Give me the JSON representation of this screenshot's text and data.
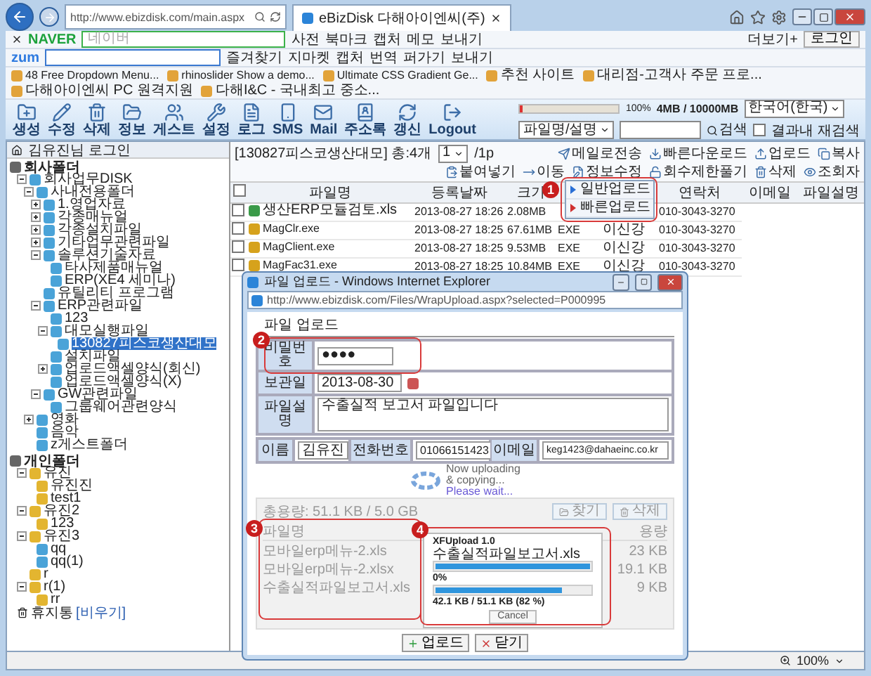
{
  "browser": {
    "address": "http://www.ebizdisk.com/main.aspx",
    "tab": {
      "title": "eBizDisk 다해아이엔씨(주)"
    }
  },
  "naver_bar": {
    "brand": "NAVER",
    "placeholder": "네이버",
    "items": [
      "사전",
      "북마크",
      "캡처",
      "메모",
      "보내기"
    ],
    "more": "더보기+",
    "login": "로그인"
  },
  "zum_bar": {
    "brand": "zum",
    "items": [
      "즐겨찾기",
      "지마켓",
      "캡처",
      "번역",
      "퍼가기",
      "보내기"
    ]
  },
  "favorites": [
    "48 Free Dropdown Menu...",
    "rhinoslider Show a demo...",
    "Ultimate CSS Gradient Ge...",
    "추천 사이트",
    "대리점-고객사 주문 프로...",
    "다해아이엔씨 PC 원격지원",
    "다해I&C - 국내최고 중소..."
  ],
  "app_toolbar": {
    "buttons": [
      "생성",
      "수정",
      "삭제",
      "정보",
      "게스트",
      "설정",
      "로그",
      "SMS",
      "Mail",
      "주소록",
      "갱신",
      "Logout"
    ],
    "quota": {
      "level": 0.02,
      "max_label": "100%",
      "reading": "4MB / 10000MB"
    },
    "language": "한국어(한국)",
    "search_field": "파일명/설명",
    "search_button": "검색",
    "research": {
      "label": "결과내 재검색",
      "checked": false
    }
  },
  "sidebar": {
    "user": "김유진님 로그인",
    "sections": [
      {
        "title": "회사폴더",
        "items": [
          {
            "label": "회사업무DISK",
            "kind": "shared",
            "selected": false,
            "expanded": true,
            "children": [
              {
                "label": "사내전용폴더",
                "kind": "shared",
                "selected": false,
                "expanded": true,
                "children": [
                  {
                    "label": "1.영업자료",
                    "kind": "shared",
                    "selected": false,
                    "expanded": false
                  },
                  {
                    "label": "각종매뉴얼",
                    "kind": "shared",
                    "selected": false,
                    "expanded": false
                  },
                  {
                    "label": "각종설치파일",
                    "kind": "shared",
                    "selected": false,
                    "expanded": false
                  },
                  {
                    "label": "기타업무관련파일",
                    "kind": "shared",
                    "selected": false,
                    "expanded": false
                  },
                  {
                    "label": "솔루션기술자료",
                    "kind": "shared",
                    "selected": false,
                    "expanded": true,
                    "children": [
                      {
                        "label": "타사제품매뉴얼",
                        "kind": "shared",
                        "selected": false
                      },
                      {
                        "label": "ERP(XE4 세미나)",
                        "kind": "shared",
                        "selected": false
                      }
                    ]
                  },
                  {
                    "label": "유틸리티 프로그램",
                    "kind": "shared",
                    "selected": false
                  },
                  {
                    "label": "ERP관련파일",
                    "kind": "shared",
                    "selected": false,
                    "expanded": true,
                    "children": [
                      {
                        "label": "123",
                        "kind": "shared",
                        "selected": false
                      },
                      {
                        "label": "대모실행파일",
                        "kind": "shared",
                        "selected": false,
                        "expanded": true,
                        "children": [
                          {
                            "label": "130827피스코생산대모",
                            "kind": "shared",
                            "selected": true
                          }
                        ]
                      },
                      {
                        "label": "설치파일",
                        "kind": "shared",
                        "selected": false
                      },
                      {
                        "label": "업로드액셀양식(회신)",
                        "kind": "shared",
                        "selected": false,
                        "expanded": false
                      },
                      {
                        "label": "업로드액셀양식(X)",
                        "kind": "shared",
                        "selected": false
                      }
                    ]
                  },
                  {
                    "label": "GW관련파일",
                    "kind": "shared",
                    "selected": false,
                    "expanded": true,
                    "children": [
                      {
                        "label": "그룹웨어관련양식",
                        "kind": "shared",
                        "selected": false
                      }
                    ]
                  }
                ]
              },
              {
                "label": "영화",
                "kind": "shared",
                "selected": false,
                "expanded": false
              },
              {
                "label": "음악",
                "kind": "shared",
                "selected": false
              },
              {
                "label": "z게스트폴더",
                "kind": "shared",
                "selected": false
              }
            ]
          }
        ]
      },
      {
        "title": "개인폴더",
        "items": [
          {
            "label": "유진",
            "kind": "personal",
            "selected": false,
            "expanded": true,
            "children": [
              {
                "label": "유진진",
                "kind": "personal",
                "selected": false
              },
              {
                "label": "test1",
                "kind": "personal",
                "selected": false
              }
            ]
          },
          {
            "label": "유진2",
            "kind": "personal",
            "selected": false,
            "expanded": true,
            "children": [
              {
                "label": "123",
                "kind": "personal",
                "selected": false
              }
            ]
          },
          {
            "label": "유진3",
            "kind": "personal",
            "selected": false,
            "expanded": true,
            "children": [
              {
                "label": "qq",
                "kind": "shared",
                "selected": false
              },
              {
                "label": "qq(1)",
                "kind": "shared",
                "selected": false
              }
            ]
          },
          {
            "label": "r",
            "kind": "personal",
            "selected": false
          },
          {
            "label": "r(1)",
            "kind": "personal",
            "selected": false,
            "expanded": true,
            "children": [
              {
                "label": "rr",
                "kind": "personal",
                "selected": false
              }
            ]
          }
        ]
      }
    ],
    "trash": {
      "label": "휴지통",
      "link": "[비우기]"
    }
  },
  "file_panel": {
    "path": "[130827피스코생산대모] 총:4개",
    "page": "1",
    "pages": "/1p",
    "actions": [
      {
        "label": "메일로전송"
      },
      {
        "label": "빠른다운로드"
      },
      {
        "label": "업로드",
        "menu": [
          {
            "label": "일반업로드",
            "color": "#2a6fd6"
          },
          {
            "label": "빠른업로드",
            "color": "#d03030"
          }
        ]
      },
      {
        "label": "복사"
      },
      {
        "label": "붙여넣기"
      },
      {
        "label": "이동"
      },
      {
        "label": "정보수정"
      },
      {
        "label": "회수제한풀기"
      },
      {
        "label": "삭제"
      },
      {
        "label": "조회자"
      }
    ],
    "select_all": {
      "checked": false
    },
    "columns": [
      {
        "label": "파일명"
      },
      {
        "label": "등록날짜"
      },
      {
        "label": "크기"
      },
      {},
      {},
      {
        "label": "연락처"
      },
      {
        "label": "이메일"
      },
      {
        "label": "파일설명"
      }
    ],
    "rows": [
      {
        "checked": false,
        "kind": "excel",
        "cells": [
          "생산ERP모듈검토.xls",
          "2013-08-27 18:26",
          "2.08MB",
          "",
          "",
          "010-3043-3270"
        ]
      },
      {
        "checked": false,
        "kind": "program",
        "cells": [
          "MagClr.exe",
          "2013-08-27 18:25",
          "67.61MB",
          "EXE",
          "이신강",
          "010-3043-3270"
        ]
      },
      {
        "checked": false,
        "kind": "program",
        "cells": [
          "MagClient.exe",
          "2013-08-27 18:25",
          "9.53MB",
          "EXE",
          "이신강",
          "010-3043-3270"
        ]
      },
      {
        "checked": false,
        "kind": "program",
        "cells": [
          "MagFac31.exe",
          "2013-08-27 18:25",
          "10.84MB",
          "EXE",
          "이신강",
          "010-3043-3270"
        ]
      }
    ]
  },
  "dialog": {
    "title": "파일 업로드 - Windows Internet Explorer",
    "url": "http://www.ebizdisk.com/Files/WrapUpload.aspx?selected=P000995",
    "heading": "파일 업로드",
    "password": {
      "label": "비밀번호",
      "value": "●●●●"
    },
    "keep_date": {
      "label": "보관일",
      "value": "2013-08-30"
    },
    "description": {
      "label": "파일설명",
      "value": "수출실적 보고서 파일입니다"
    },
    "name": {
      "label": "이름",
      "value": "김유진"
    },
    "phone": {
      "label": "전화번호",
      "value": "01066151423"
    },
    "email": {
      "label": "이메일",
      "value": "keg1423@dahaeinc.co.kr"
    },
    "wait": {
      "line1": "Now uploading",
      "line2": "& copying...",
      "line3": "Please wait..."
    },
    "upload": {
      "total": "총용량: 51.1 KB / 5.0 GB",
      "find": "찾기",
      "remove": "삭제",
      "columns": [
        "파일명",
        "용량"
      ],
      "files": [
        {
          "name": "모바일erp메뉴-2.xls",
          "size": "23 KB"
        },
        {
          "name": "모바일erp메뉴-2.xlsx",
          "size": "19.1 KB"
        },
        {
          "name": "수출실적파일보고서.xls",
          "size": "9 KB"
        }
      ],
      "progress": {
        "title": "XFUpload 1.0",
        "file": "수출실적파일보고서.xls",
        "file_bar": {
          "level": 1
        },
        "percent": "0%",
        "total_bar": {
          "level": 0.82
        },
        "reading": "42.1 KB / 51.1 KB (82 %)",
        "cancel": "Cancel"
      }
    },
    "buttons": [
      "업로드",
      "닫기"
    ]
  },
  "annotations": [
    "1",
    "2",
    "3",
    "4"
  ],
  "status_bar": {
    "zoom": "100%"
  }
}
